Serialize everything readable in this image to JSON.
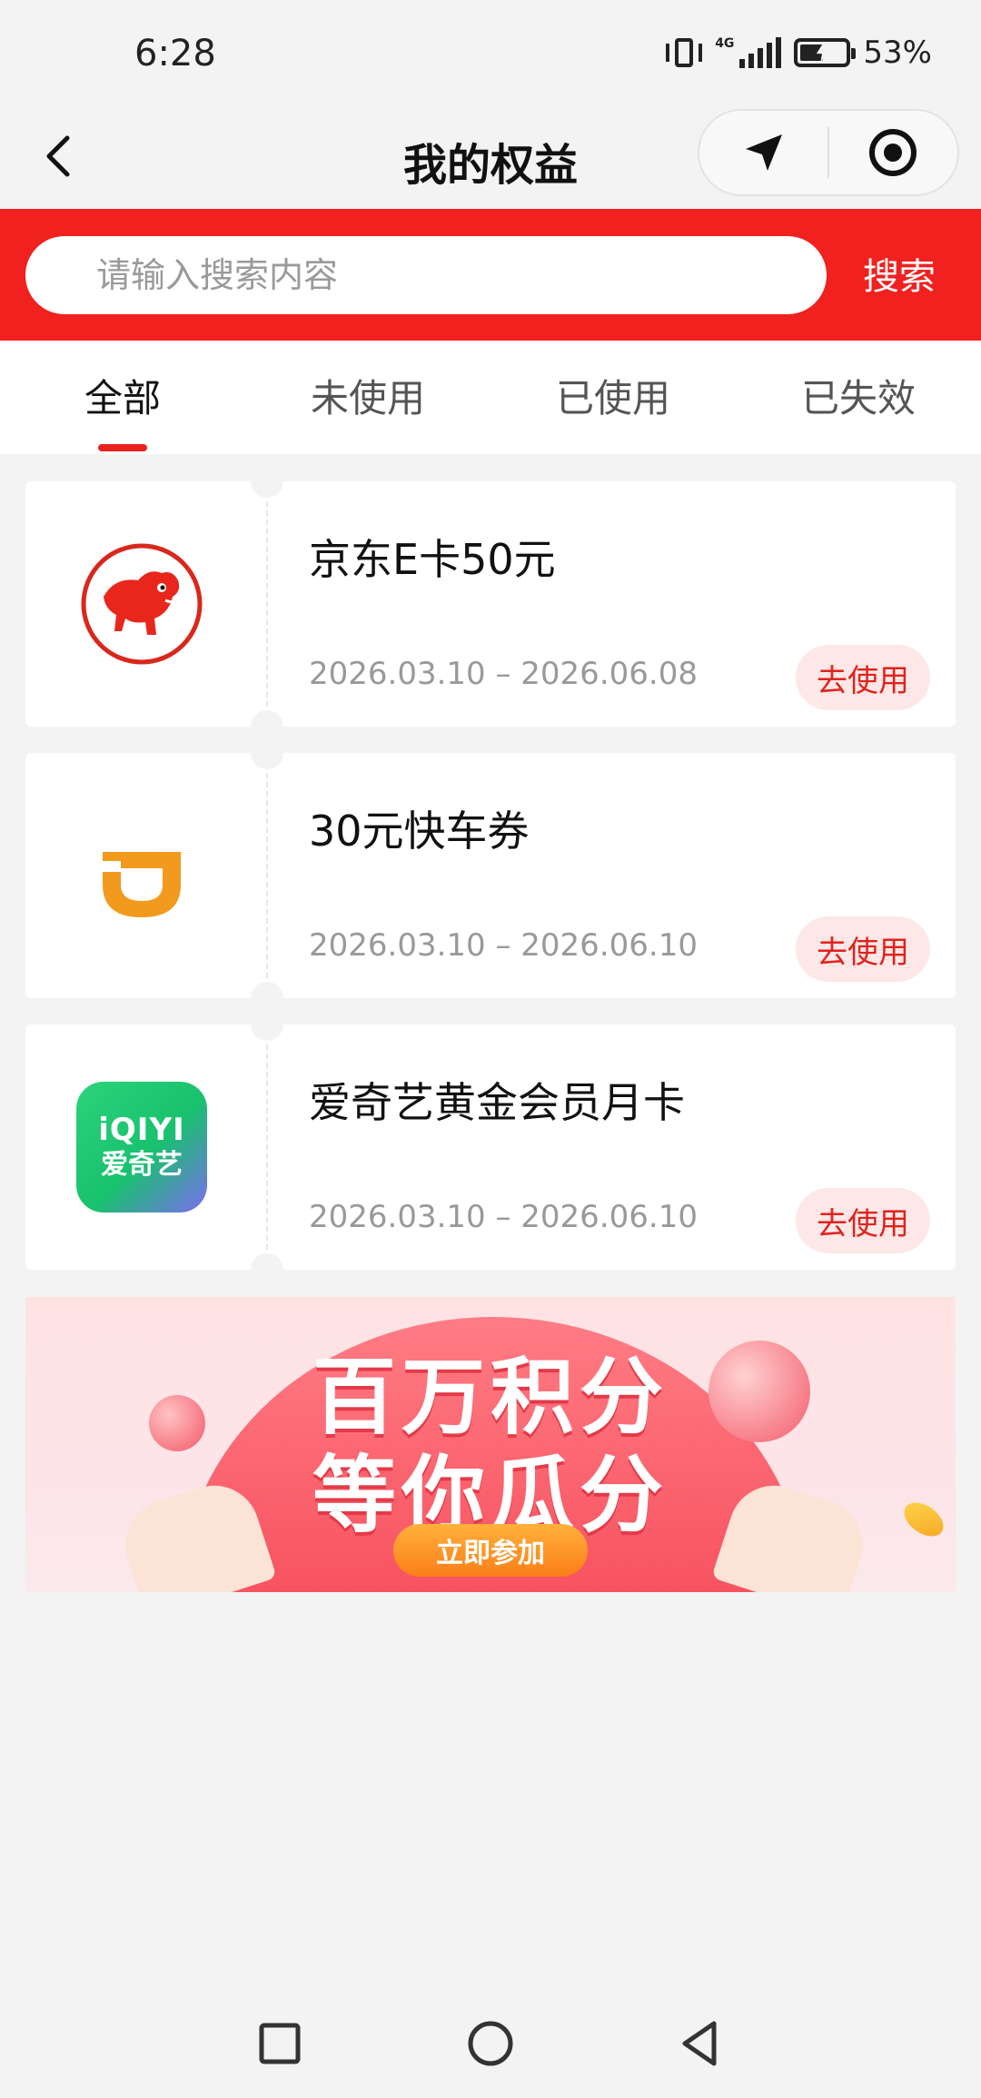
{
  "status_bar": {
    "time": "6:28",
    "network": "4G",
    "battery_percent": "53%",
    "battery_level": 0.53
  },
  "header": {
    "title": "我的权益",
    "back_icon": "chevron-left-icon",
    "capsule_icons": [
      "navigation-arrow-icon",
      "target-circle-icon"
    ]
  },
  "search": {
    "placeholder": "请输入搜索内容",
    "button_label": "搜索"
  },
  "tabs": [
    {
      "label": "全部",
      "active": true
    },
    {
      "label": "未使用",
      "active": false
    },
    {
      "label": "已使用",
      "active": false
    },
    {
      "label": "已失效",
      "active": false
    }
  ],
  "coupons": [
    {
      "name": "京东E卡50元",
      "validity": "2026.03.10 – 2026.06.08",
      "action": "去使用",
      "logo": "jd-dog-logo-icon"
    },
    {
      "name": "30元快车券",
      "validity": "2026.03.10 – 2026.06.10",
      "action": "去使用",
      "logo": "didi-logo-icon"
    },
    {
      "name": "爱奇艺黄金会员月卡",
      "validity": "2026.03.10 – 2026.06.10",
      "action": "去使用",
      "logo": "iqiyi-logo-icon"
    }
  ],
  "banner": {
    "line1": "百万积分",
    "line2": "等你瓜分",
    "button": "立即参加"
  },
  "logo_text": {
    "iqiyi_top": "iQIYI",
    "iqiyi_bottom": "爱奇艺"
  },
  "colors": {
    "brand_red": "#f0211f",
    "action_text": "#e0231e",
    "action_bg": "#fde7e7"
  },
  "nav_bar": {
    "icons": [
      "recents-square-icon",
      "home-circle-icon",
      "back-triangle-icon"
    ]
  }
}
